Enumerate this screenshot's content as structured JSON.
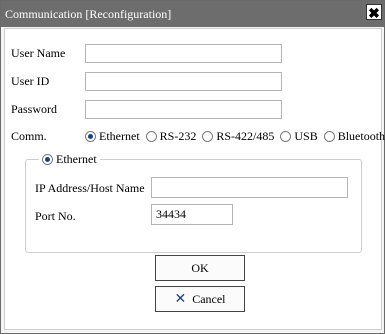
{
  "dialog": {
    "title": "Communication [Reconfiguration]",
    "close_glyph": "✖"
  },
  "form": {
    "user_name_label": "User Name",
    "user_name_value": "",
    "user_id_label": "User ID",
    "user_id_value": "",
    "password_label": "Password",
    "password_value": "",
    "comm_label": "Comm.",
    "comm_options": [
      "Ethernet",
      "RS-232",
      "RS-422/485",
      "USB",
      "Bluetooth"
    ],
    "comm_selected": "Ethernet"
  },
  "ethernet": {
    "group_label": "Ethernet",
    "ip_label": "IP Address/Host Name",
    "ip_value": "",
    "port_label": "Port No.",
    "port_value": "34434"
  },
  "buttons": {
    "ok_label": "OK",
    "cancel_label": "Cancel",
    "cancel_icon": "close-x-icon"
  },
  "colors": {
    "titlebar": "#6d6d6d",
    "radio_dot": "#1a3e8f",
    "cancel_icon": "#1f3f86"
  }
}
